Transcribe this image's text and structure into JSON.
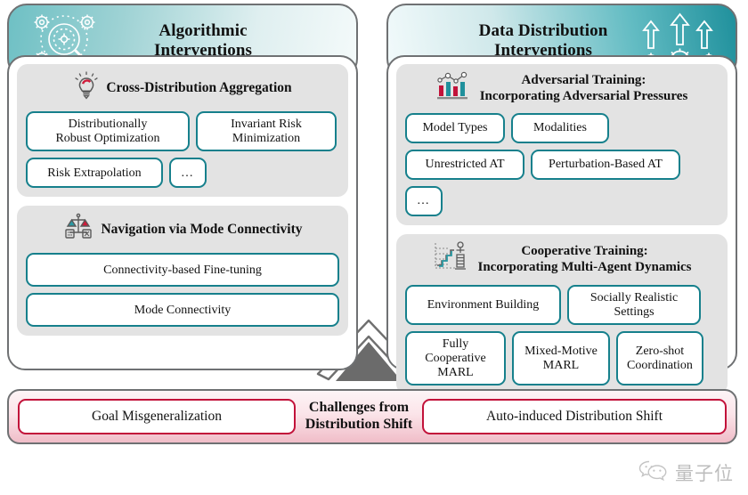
{
  "columns": [
    {
      "id": "algorithmic",
      "header_title": "Algorithmic\nInterventions",
      "header_icon": "magnifier-gears-icon",
      "groups": [
        {
          "icon": "lightbulb-icon",
          "title": "Cross-Distribution Aggregation",
          "chips": [
            "Distributionally\nRobust Optimization",
            "Invariant Risk\nMinimization",
            "Risk Extrapolation",
            "…"
          ]
        },
        {
          "icon": "balance-scale-icon",
          "title": "Navigation via Mode Connectivity",
          "chips": [
            "Connectivity-based Fine-tuning",
            "Mode Connectivity"
          ]
        }
      ]
    },
    {
      "id": "data-distribution",
      "header_title": "Data Distribution\nInterventions",
      "header_icon": "arrows-gears-icon",
      "groups": [
        {
          "icon": "bar-chart-line-icon",
          "title": "Adversarial Training:\nIncorporating Adversarial Pressures",
          "chips": [
            "Model Types",
            "Modalities",
            "Unrestricted AT",
            "Perturbation-Based AT",
            "…"
          ]
        },
        {
          "icon": "stairs-agent-icon",
          "title": "Cooperative Training:\nIncorporating Multi-Agent Dynamics",
          "chips": [
            "Environment Building",
            "Socially Realistic\nSettings",
            "Fully Cooperative\nMARL",
            "Mixed-Motive\nMARL",
            "Zero-shot\nCoordination"
          ]
        }
      ]
    }
  ],
  "bottom": {
    "left_chip": "Goal Misgeneralization",
    "title": "Challenges from\nDistribution Shift",
    "right_chip": "Auto-induced Distribution Shift"
  },
  "watermark": {
    "icon": "wechat-icon",
    "text": "量子位"
  },
  "colors": {
    "teal_border": "#16808c",
    "red_border": "#c2123a",
    "panel_border": "#6f7173",
    "group_bg": "#e3e3e3",
    "header_teal_dark": "#1f909c",
    "header_teal_light": "#f4fafa",
    "bottom_pink": "#f0bdc8",
    "arrow_fill": "#6b6b6b"
  }
}
